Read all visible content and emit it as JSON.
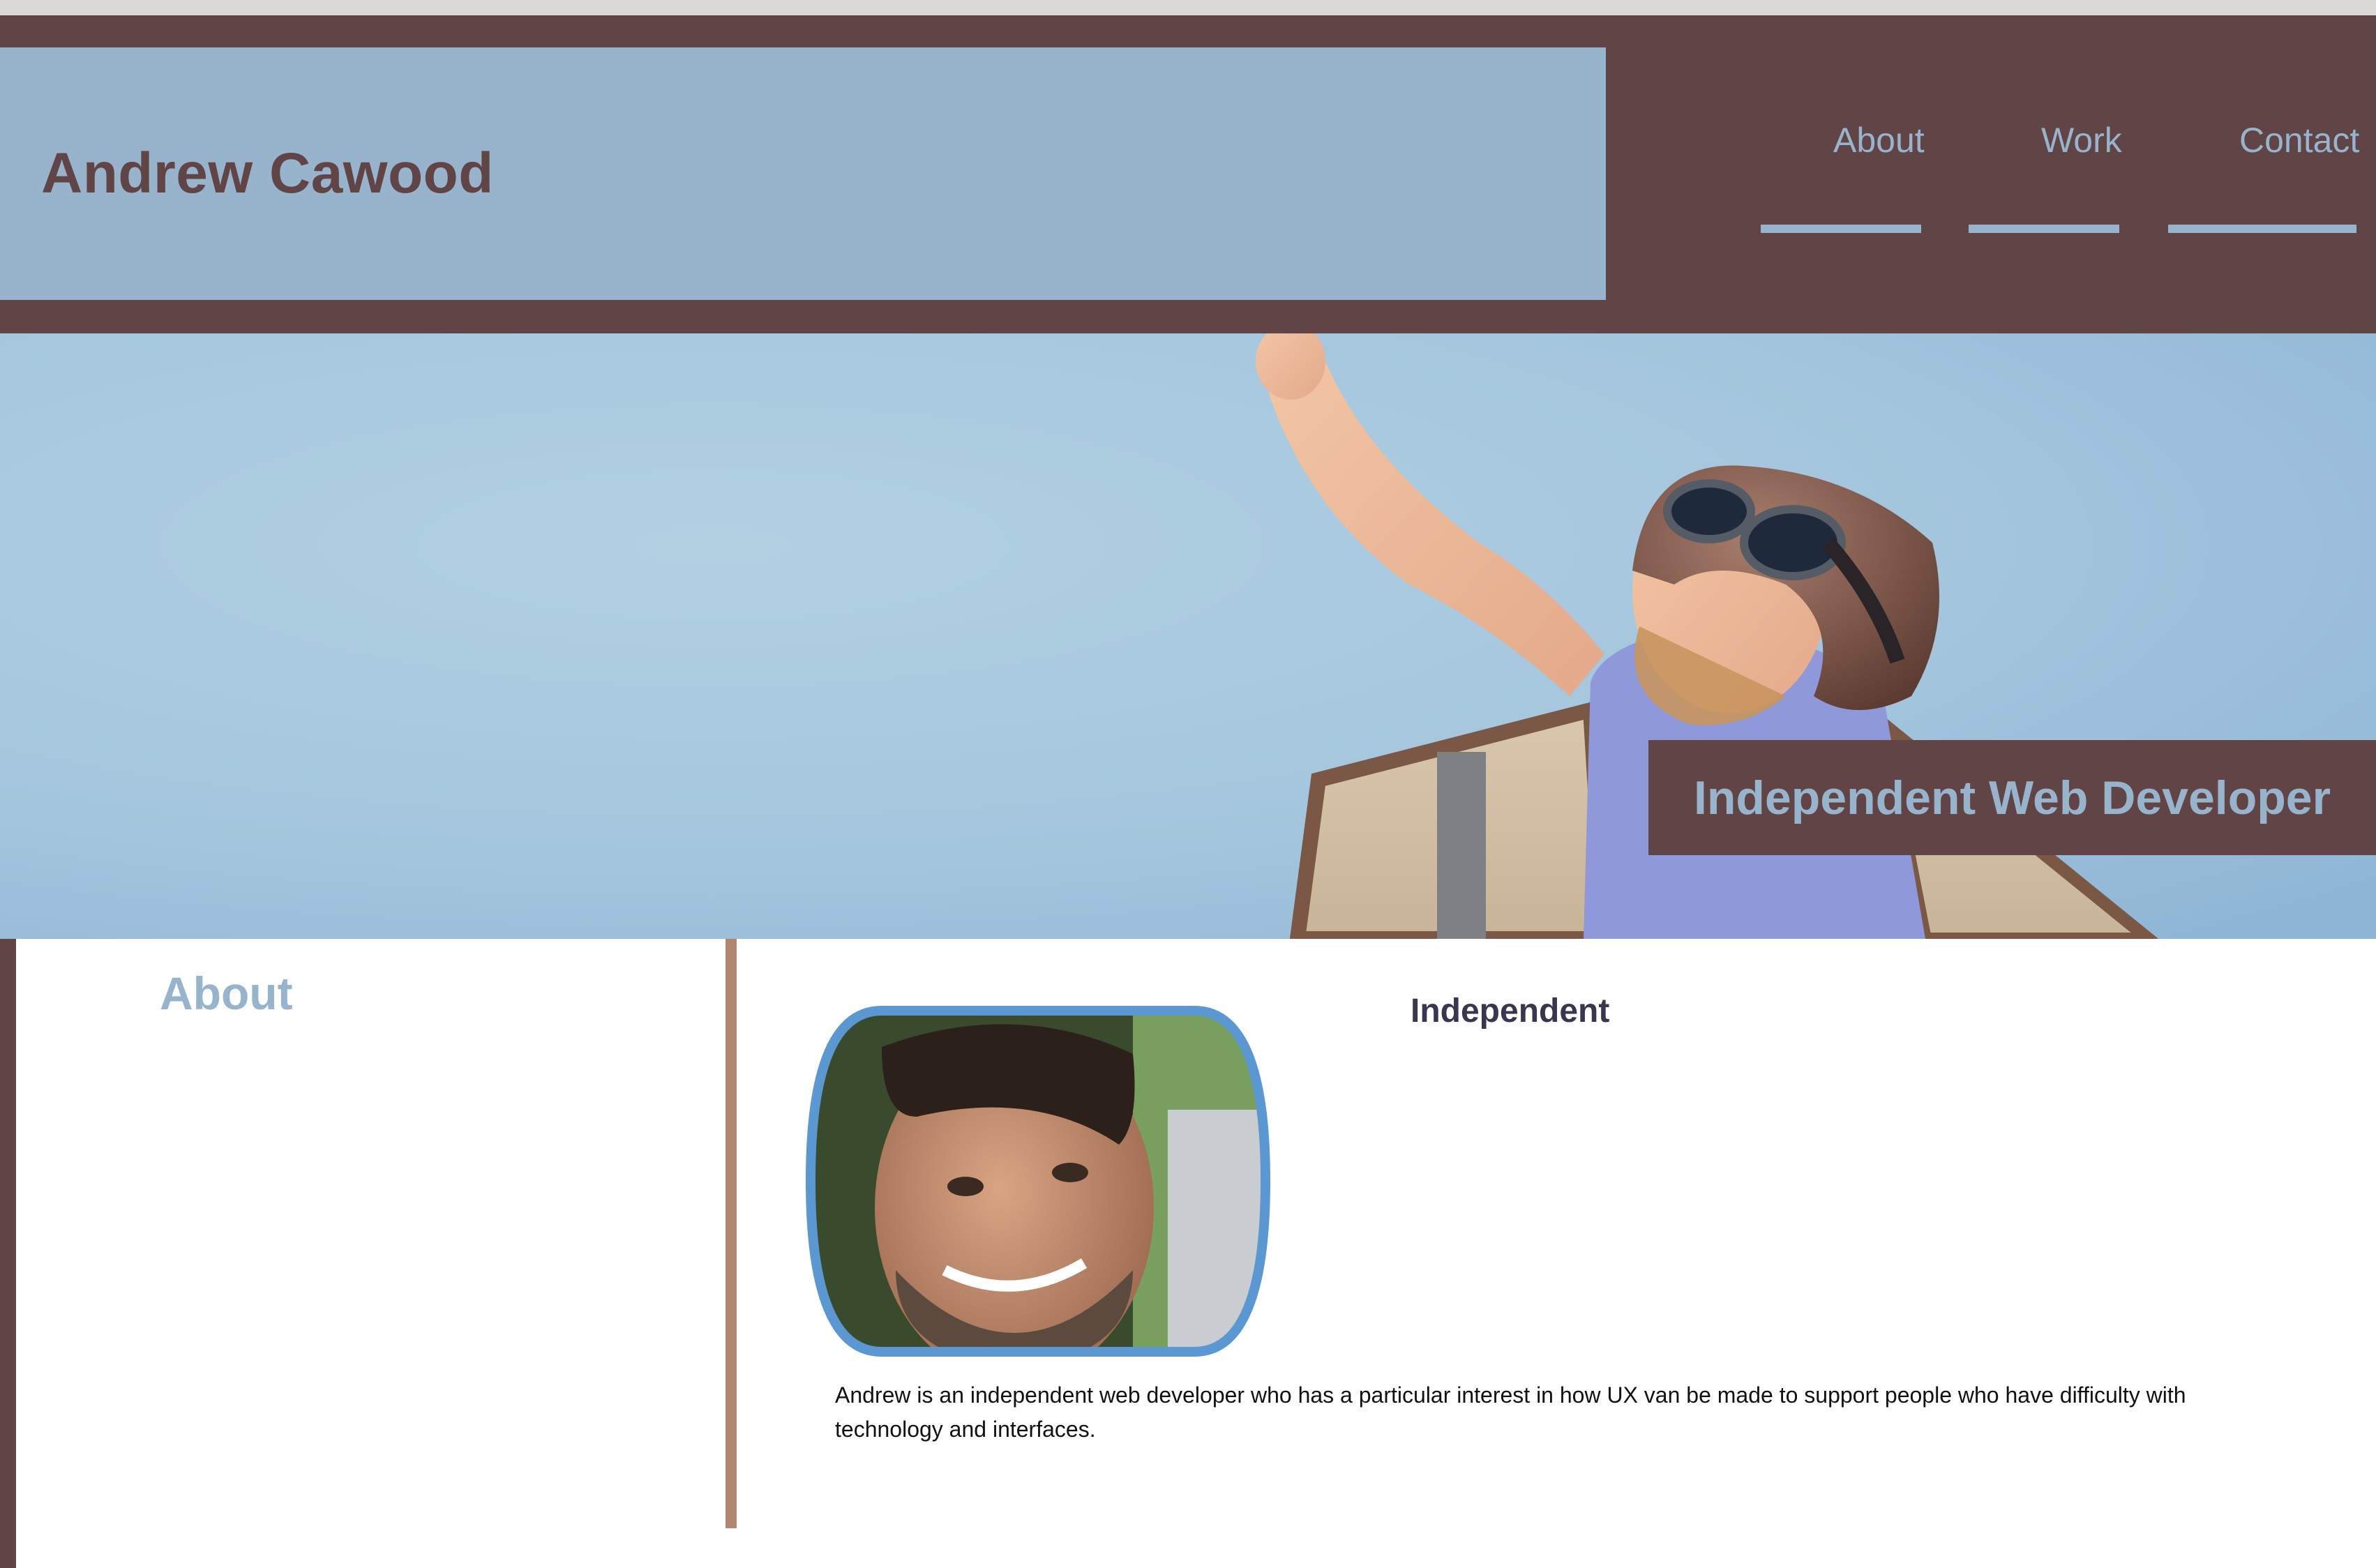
{
  "header": {
    "site_title": "Andrew Cawood",
    "nav": [
      {
        "label": "About"
      },
      {
        "label": "Work"
      },
      {
        "label": "Contact"
      }
    ]
  },
  "hero": {
    "tagline": "Independent Web Developer",
    "image": "child-aviator-photo"
  },
  "about": {
    "heading": "About",
    "section_heading": "Independent",
    "portrait": "portrait-photo",
    "bio": "Andrew is an independent web developer who has a particular interest in how UX van be made to support people who have difficulty with technology and interfaces."
  },
  "colors": {
    "brand_dark": "#614445",
    "brand_light": "#98b4cd",
    "divider": "#b08670",
    "portrait_ring": "#5b97d1"
  }
}
